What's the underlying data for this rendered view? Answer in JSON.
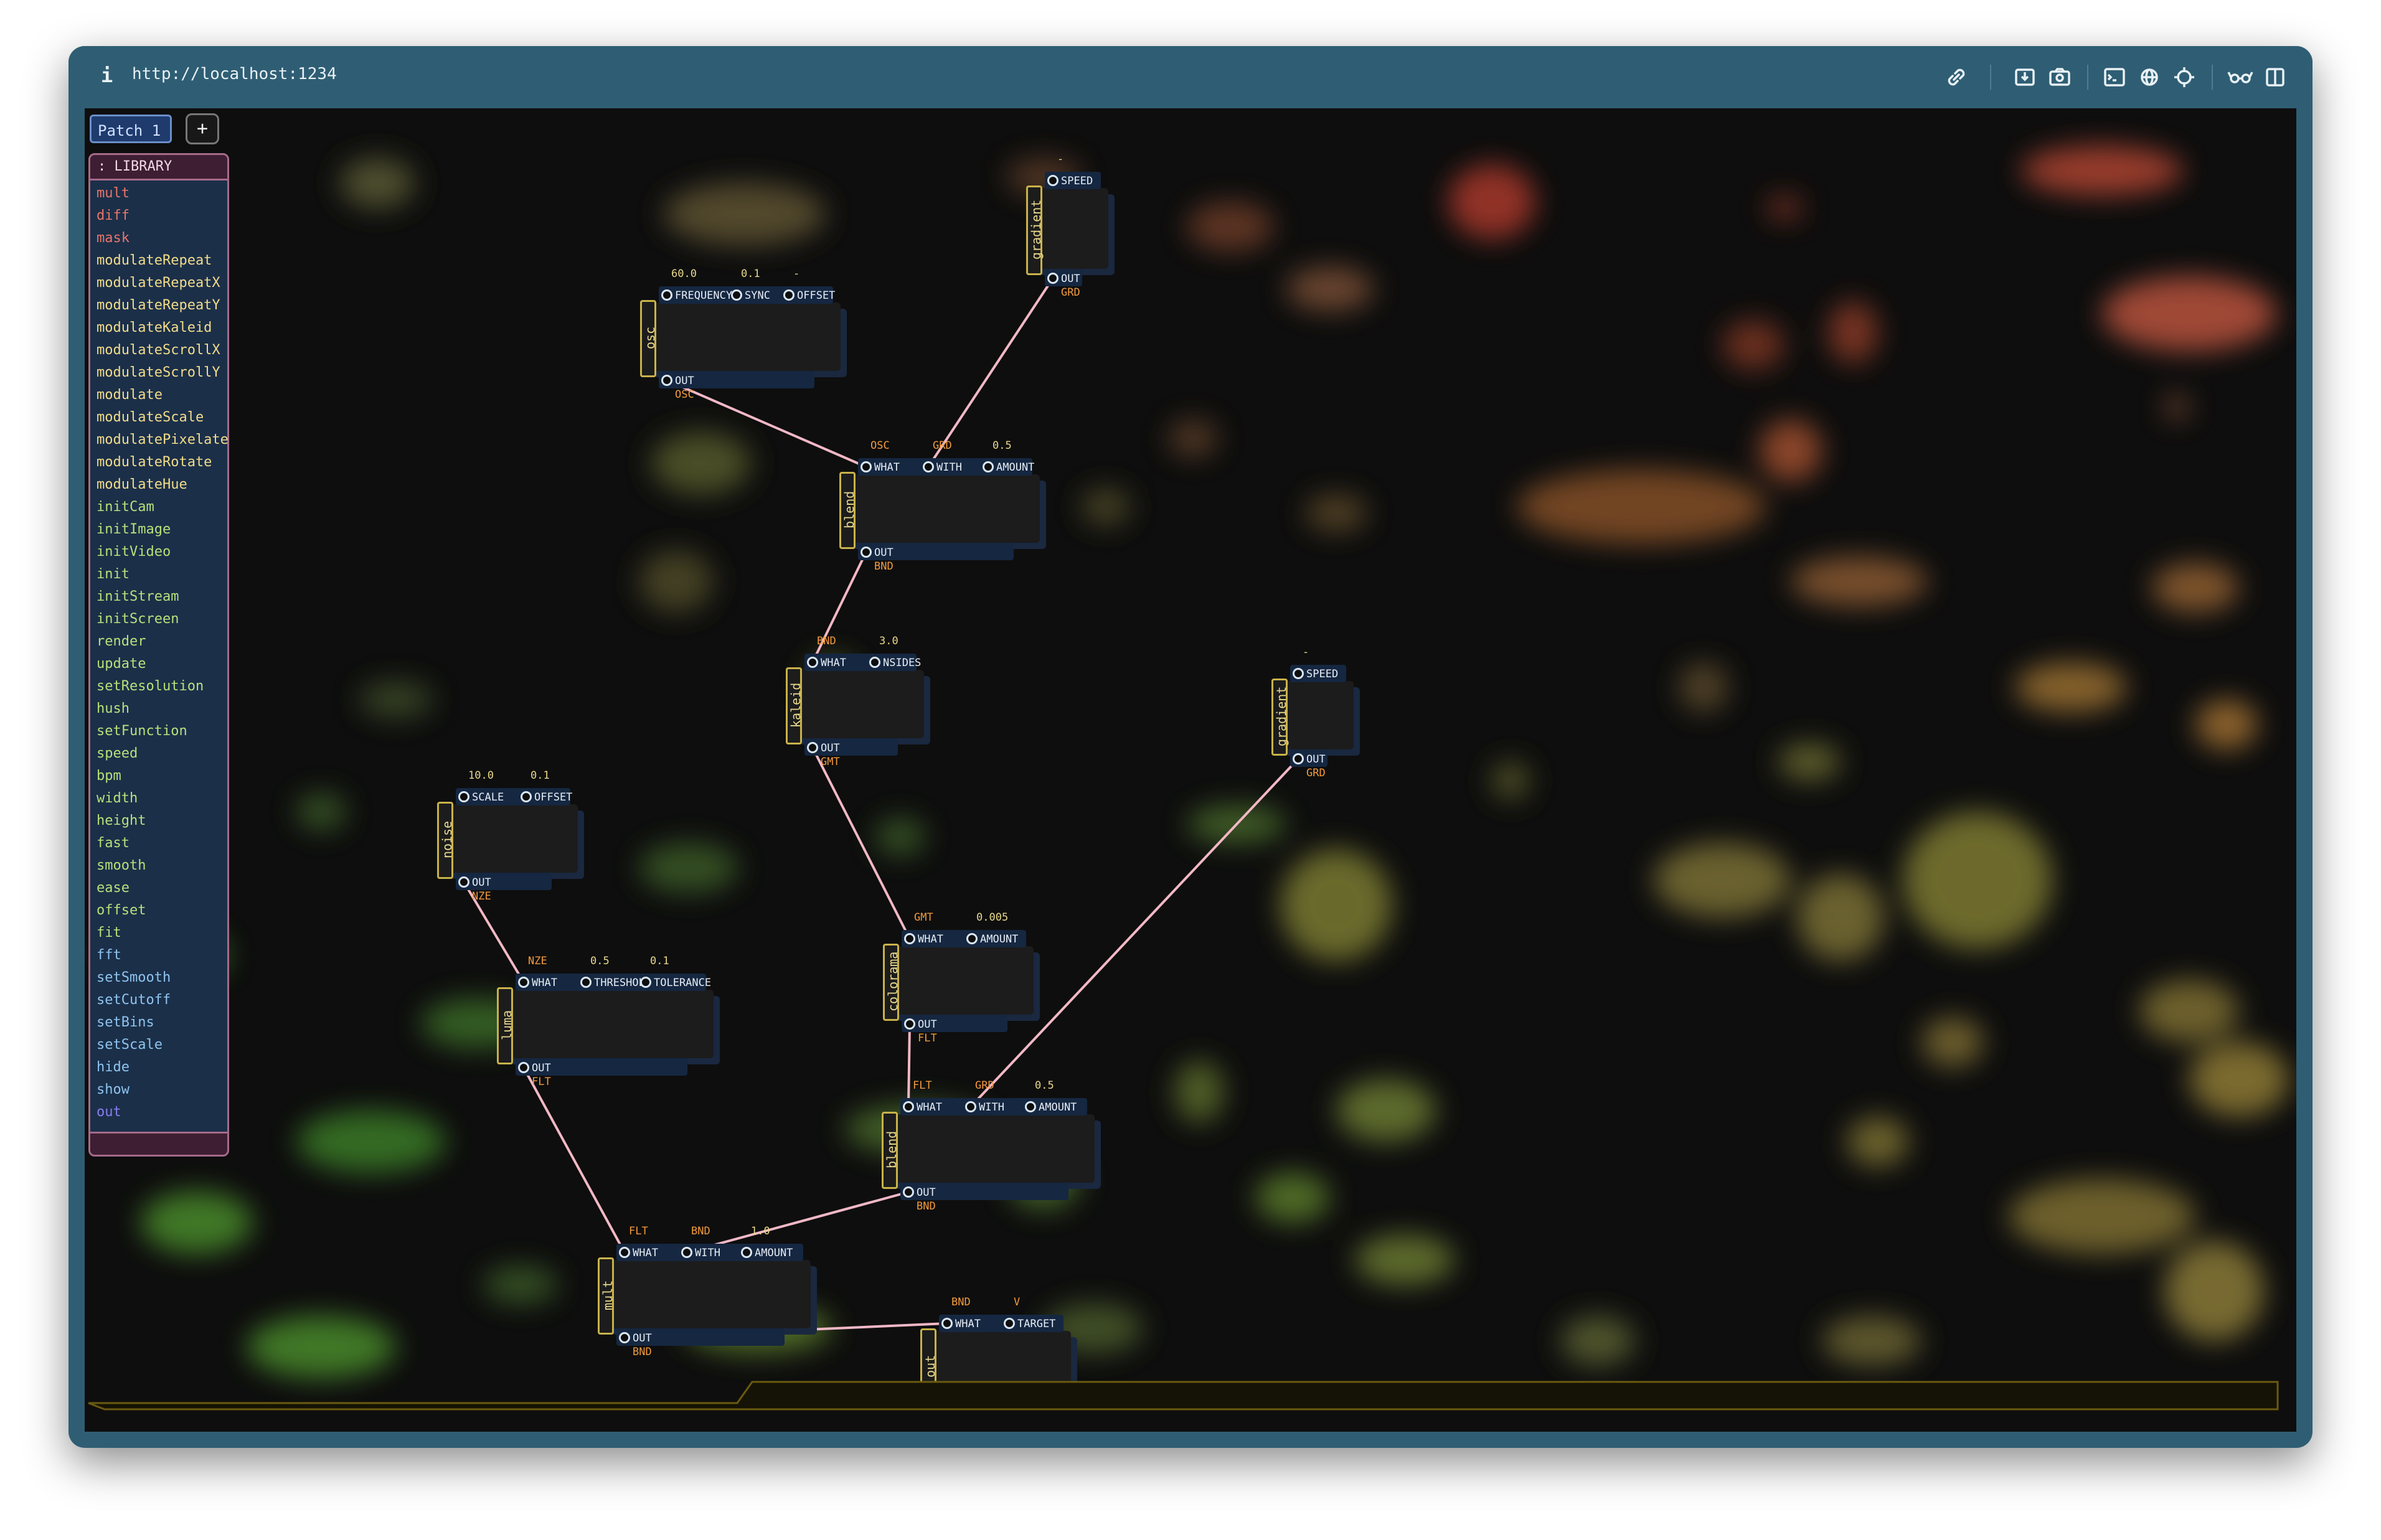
{
  "titlebar": {
    "info_label": "i",
    "url": "http://localhost:1234",
    "icons": [
      "link-icon",
      "download-icon",
      "camera-icon",
      "terminal-icon",
      "globe-icon",
      "crosshair-icon",
      "glasses-icon",
      "split-view-icon"
    ]
  },
  "tabs": {
    "patch": "Patch 1",
    "add": "+"
  },
  "library": {
    "title": ": LIBRARY",
    "items": [
      {
        "label": "mult",
        "color": "#e9746a"
      },
      {
        "label": "diff",
        "color": "#e9746a"
      },
      {
        "label": "mask",
        "color": "#e9746a"
      },
      {
        "label": "modulateRepeat",
        "color": "#f2dc8a"
      },
      {
        "label": "modulateRepeatX",
        "color": "#f2dc8a"
      },
      {
        "label": "modulateRepeatY",
        "color": "#f2dc8a"
      },
      {
        "label": "modulateKaleid",
        "color": "#f2dc8a"
      },
      {
        "label": "modulateScrollX",
        "color": "#f2dc8a"
      },
      {
        "label": "modulateScrollY",
        "color": "#f2dc8a"
      },
      {
        "label": "modulate",
        "color": "#f2dc8a"
      },
      {
        "label": "modulateScale",
        "color": "#f2dc8a"
      },
      {
        "label": "modulatePixelate",
        "color": "#f2dc8a"
      },
      {
        "label": "modulateRotate",
        "color": "#f2dc8a"
      },
      {
        "label": "modulateHue",
        "color": "#f2dc8a"
      },
      {
        "label": "initCam",
        "color": "#b6e07a"
      },
      {
        "label": "initImage",
        "color": "#b6e07a"
      },
      {
        "label": "initVideo",
        "color": "#b6e07a"
      },
      {
        "label": "init",
        "color": "#b6e07a"
      },
      {
        "label": "initStream",
        "color": "#b6e07a"
      },
      {
        "label": "initScreen",
        "color": "#b6e07a"
      },
      {
        "label": "render",
        "color": "#b6e07a"
      },
      {
        "label": "update",
        "color": "#b6e07a"
      },
      {
        "label": "setResolution",
        "color": "#b6e07a"
      },
      {
        "label": "hush",
        "color": "#b6e07a"
      },
      {
        "label": "setFunction",
        "color": "#b6e07a"
      },
      {
        "label": "speed",
        "color": "#b6e07a"
      },
      {
        "label": "bpm",
        "color": "#b6e07a"
      },
      {
        "label": "width",
        "color": "#b6e07a"
      },
      {
        "label": "height",
        "color": "#b6e07a"
      },
      {
        "label": "fast",
        "color": "#b6e07a"
      },
      {
        "label": "smooth",
        "color": "#b6e07a"
      },
      {
        "label": "ease",
        "color": "#b6e07a"
      },
      {
        "label": "offset",
        "color": "#b6e07a"
      },
      {
        "label": "fit",
        "color": "#b6e07a"
      },
      {
        "label": "fft",
        "color": "#8ec4ee"
      },
      {
        "label": "setSmooth",
        "color": "#8ec4ee"
      },
      {
        "label": "setCutoff",
        "color": "#8ec4ee"
      },
      {
        "label": "setBins",
        "color": "#8ec4ee"
      },
      {
        "label": "setScale",
        "color": "#8ec4ee"
      },
      {
        "label": "hide",
        "color": "#8ec4ee"
      },
      {
        "label": "show",
        "color": "#8ec4ee"
      },
      {
        "label": "out",
        "color": "#8a7df0"
      }
    ]
  },
  "nodes": {
    "osc1": {
      "title": "osc",
      "ins": [
        {
          "label": "FREQUENCY",
          "value": "60.0",
          "vcolor": "#e8d88c"
        },
        {
          "label": "SYNC",
          "value": "0.1",
          "vcolor": "#e8d88c"
        },
        {
          "label": "OFFSET",
          "value": "-",
          "vcolor": "#e8d88c"
        }
      ],
      "out_label": "OUT",
      "out_value": "OSC"
    },
    "gradient1": {
      "title": "gradient",
      "ins": [
        {
          "label": "SPEED",
          "value": "-",
          "vcolor": "#e8d88c"
        }
      ],
      "out_label": "OUT",
      "out_value": "GRD"
    },
    "blend1": {
      "title": "blend",
      "ins": [
        {
          "label": "WHAT",
          "value": "OSC",
          "vcolor": "#f29a3c"
        },
        {
          "label": "WITH",
          "value": "GRD",
          "vcolor": "#f29a3c"
        },
        {
          "label": "AMOUNT",
          "value": "0.5",
          "vcolor": "#e8d88c"
        }
      ],
      "out_label": "OUT",
      "out_value": "BND"
    },
    "kaleid1": {
      "title": "kaleid",
      "ins": [
        {
          "label": "WHAT",
          "value": "BND",
          "vcolor": "#f29a3c"
        },
        {
          "label": "NSIDES",
          "value": "3.0",
          "vcolor": "#e8d88c"
        }
      ],
      "out_label": "OUT",
      "out_value": "GMT"
    },
    "gradient2": {
      "title": "gradient",
      "ins": [
        {
          "label": "SPEED",
          "value": "-",
          "vcolor": "#e8d88c"
        }
      ],
      "out_label": "OUT",
      "out_value": "GRD"
    },
    "noise1": {
      "title": "noise",
      "ins": [
        {
          "label": "SCALE",
          "value": "10.0",
          "vcolor": "#e8d88c"
        },
        {
          "label": "OFFSET",
          "value": "0.1",
          "vcolor": "#e8d88c"
        }
      ],
      "out_label": "OUT",
      "out_value": "NZE"
    },
    "colorama1": {
      "title": "colorama",
      "ins": [
        {
          "label": "WHAT",
          "value": "GMT",
          "vcolor": "#f29a3c"
        },
        {
          "label": "AMOUNT",
          "value": "0.005",
          "vcolor": "#e8d88c"
        }
      ],
      "out_label": "OUT",
      "out_value": "FLT"
    },
    "luma1": {
      "title": "luma",
      "ins": [
        {
          "label": "WHAT",
          "value": "NZE",
          "vcolor": "#f29a3c"
        },
        {
          "label": "THRESHOLD",
          "value": "0.5",
          "vcolor": "#e8d88c"
        },
        {
          "label": "TOLERANCE",
          "value": "0.1",
          "vcolor": "#e8d88c"
        }
      ],
      "out_label": "OUT",
      "out_value": "FLT"
    },
    "blend2": {
      "title": "blend",
      "ins": [
        {
          "label": "WHAT",
          "value": "FLT",
          "vcolor": "#f29a3c"
        },
        {
          "label": "WITH",
          "value": "GRD",
          "vcolor": "#f29a3c"
        },
        {
          "label": "AMOUNT",
          "value": "0.5",
          "vcolor": "#e8d88c"
        }
      ],
      "out_label": "OUT",
      "out_value": "BND"
    },
    "mult1": {
      "title": "mult",
      "ins": [
        {
          "label": "WHAT",
          "value": "FLT",
          "vcolor": "#f29a3c"
        },
        {
          "label": "WITH",
          "value": "BND",
          "vcolor": "#f29a3c"
        },
        {
          "label": "AMOUNT",
          "value": "1.0",
          "vcolor": "#e8d88c"
        }
      ],
      "out_label": "OUT",
      "out_value": "BND"
    },
    "out1": {
      "title": "out",
      "ins": [
        {
          "label": "WHAT",
          "value": "BND",
          "vcolor": "#f29a3c"
        },
        {
          "label": "TARGET",
          "value": "V",
          "vcolor": "#f29a3c"
        }
      ]
    }
  },
  "connections": [
    [
      "osc1.out",
      "blend1.in0"
    ],
    [
      "gradient1.out",
      "blend1.in1"
    ],
    [
      "blend1.out",
      "kaleid1.in0"
    ],
    [
      "kaleid1.out",
      "colorama1.in0"
    ],
    [
      "colorama1.out",
      "blend2.in0"
    ],
    [
      "gradient2.out",
      "blend2.in1"
    ],
    [
      "noise1.out",
      "luma1.in0"
    ],
    [
      "luma1.out",
      "mult1.in0"
    ],
    [
      "blend2.out",
      "mult1.in1"
    ],
    [
      "mult1.out",
      "out1.in0"
    ]
  ],
  "colors": {
    "wire": "#f2b8c6",
    "accent": "#c9b24a",
    "port_value": "#f29a3c",
    "param_value": "#e8d88c"
  }
}
